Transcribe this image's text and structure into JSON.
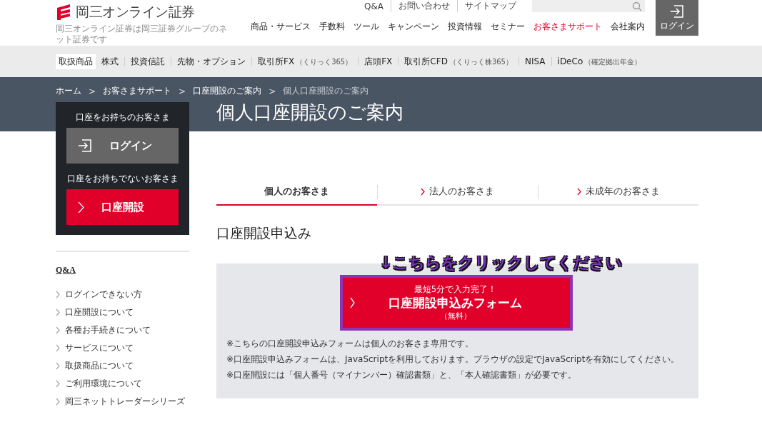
{
  "header": {
    "logo": "岡三オンライン証券",
    "tagline": "岡三オンライン証券は岡三証券グループのネット証券です",
    "utility_links": [
      "Q&A",
      "お問い合わせ",
      "サイトマップ"
    ],
    "nav": [
      {
        "label": "商品・サービス",
        "selected": false
      },
      {
        "label": "手数料",
        "selected": false
      },
      {
        "label": "ツール",
        "selected": false
      },
      {
        "label": "キャンペーン",
        "selected": false
      },
      {
        "label": "投資情報",
        "selected": false
      },
      {
        "label": "セミナー",
        "selected": false
      },
      {
        "label": "お客さまサポート",
        "selected": true
      },
      {
        "label": "会社案内",
        "selected": false
      }
    ],
    "login_button": "ログイン"
  },
  "category_bar": [
    {
      "label": "取扱商品",
      "selected": true
    },
    {
      "label": "株式",
      "selected": false
    },
    {
      "label": "投資信託",
      "selected": false
    },
    {
      "label": "先物・オプション",
      "selected": false
    },
    {
      "label": "取引所FX",
      "note": "（くりっく365）",
      "selected": false
    },
    {
      "label": "店頭FX",
      "selected": false
    },
    {
      "label": "取引所CFD",
      "note": "（くりっく株365）",
      "selected": false
    },
    {
      "label": "NISA",
      "selected": false
    },
    {
      "label": "iDeCo",
      "note": "（確定拠出年金）",
      "selected": false
    }
  ],
  "breadcrumb": [
    {
      "label": "ホーム",
      "current": false
    },
    {
      "label": "お客さまサポート",
      "current": false
    },
    {
      "label": "口座開設のご案内",
      "current": false
    },
    {
      "label": "個人口座開設のご案内",
      "current": true
    }
  ],
  "breadcrumb_separator": ">",
  "page_title": "個人口座開設のご案内",
  "sidebar": {
    "existing_label": "口座をお持ちのお客さま",
    "login_button": "ログイン",
    "new_label": "口座をお持ちでないお客さま",
    "open_button": "口座開設",
    "qa_heading": "Q&A",
    "qa_items": [
      "ログインできない方",
      "口座開設について",
      "各種お手続きについて",
      "サービスについて",
      "取扱商品について",
      "ご利用環境について",
      "岡三ネットトレーダーシリーズ"
    ]
  },
  "tabs": [
    {
      "label": "個人のお客さま",
      "selected": true
    },
    {
      "label": "法人のお客さま",
      "selected": false
    },
    {
      "label": "未成年のお客さま",
      "selected": false
    }
  ],
  "section_heading": "口座開設申込み",
  "annotation": "↓こちらをクリックしてください",
  "apply_button": {
    "lead": "最短5分で入力完了！",
    "label": "口座開設申込みフォーム",
    "note": "（無料）"
  },
  "notes": [
    "※こちらの口座開設申込みフォームは個人のお客さま専用です。",
    "※口座開設申込みフォームは、JavaScriptを利用しております。ブラウザの設定でJavaScriptを有効にしてください。",
    "※口座開設には「個人番号（マイナンバー）確認書類」と、「本人確認書類」が必要です。"
  ]
}
